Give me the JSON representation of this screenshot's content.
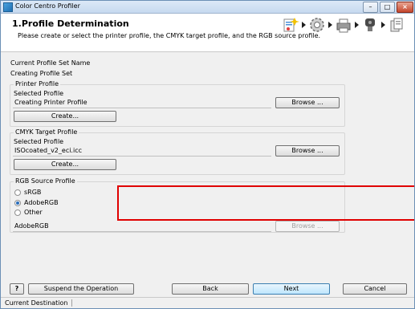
{
  "window": {
    "title": "Color Centro Profiler"
  },
  "header": {
    "title": "1.Profile Determination",
    "description": "Please create or select the printer profile, the CMYK target profile, and the RGB source profile."
  },
  "profile_set": {
    "label": "Current Profile Set Name",
    "value": "Creating Profile Set"
  },
  "printer_profile": {
    "group_label": "Printer Profile",
    "selected_label": "Selected Profile",
    "value": "Creating Printer Profile",
    "browse_label": "Browse ...",
    "create_label": "Create..."
  },
  "cmyk_profile": {
    "group_label": "CMYK Target Profile",
    "selected_label": "Selected Profile",
    "value": "ISOcoated_v2_eci.icc",
    "browse_label": "Browse ...",
    "create_label": "Create..."
  },
  "rgb_profile": {
    "group_label": "RGB Source Profile",
    "options": [
      "sRGB",
      "AdobeRGB",
      "Other"
    ],
    "selected": "AdobeRGB",
    "value": "AdobeRGB",
    "browse_label": "Browse ..."
  },
  "footer": {
    "help_label": "?",
    "suspend_label": "Suspend the Operation",
    "back_label": "Back",
    "next_label": "Next",
    "cancel_label": "Cancel"
  },
  "status": {
    "text": "Current Destination"
  },
  "colors": {
    "highlight_box": "#e00000",
    "primary_button": "#bee6fd"
  }
}
